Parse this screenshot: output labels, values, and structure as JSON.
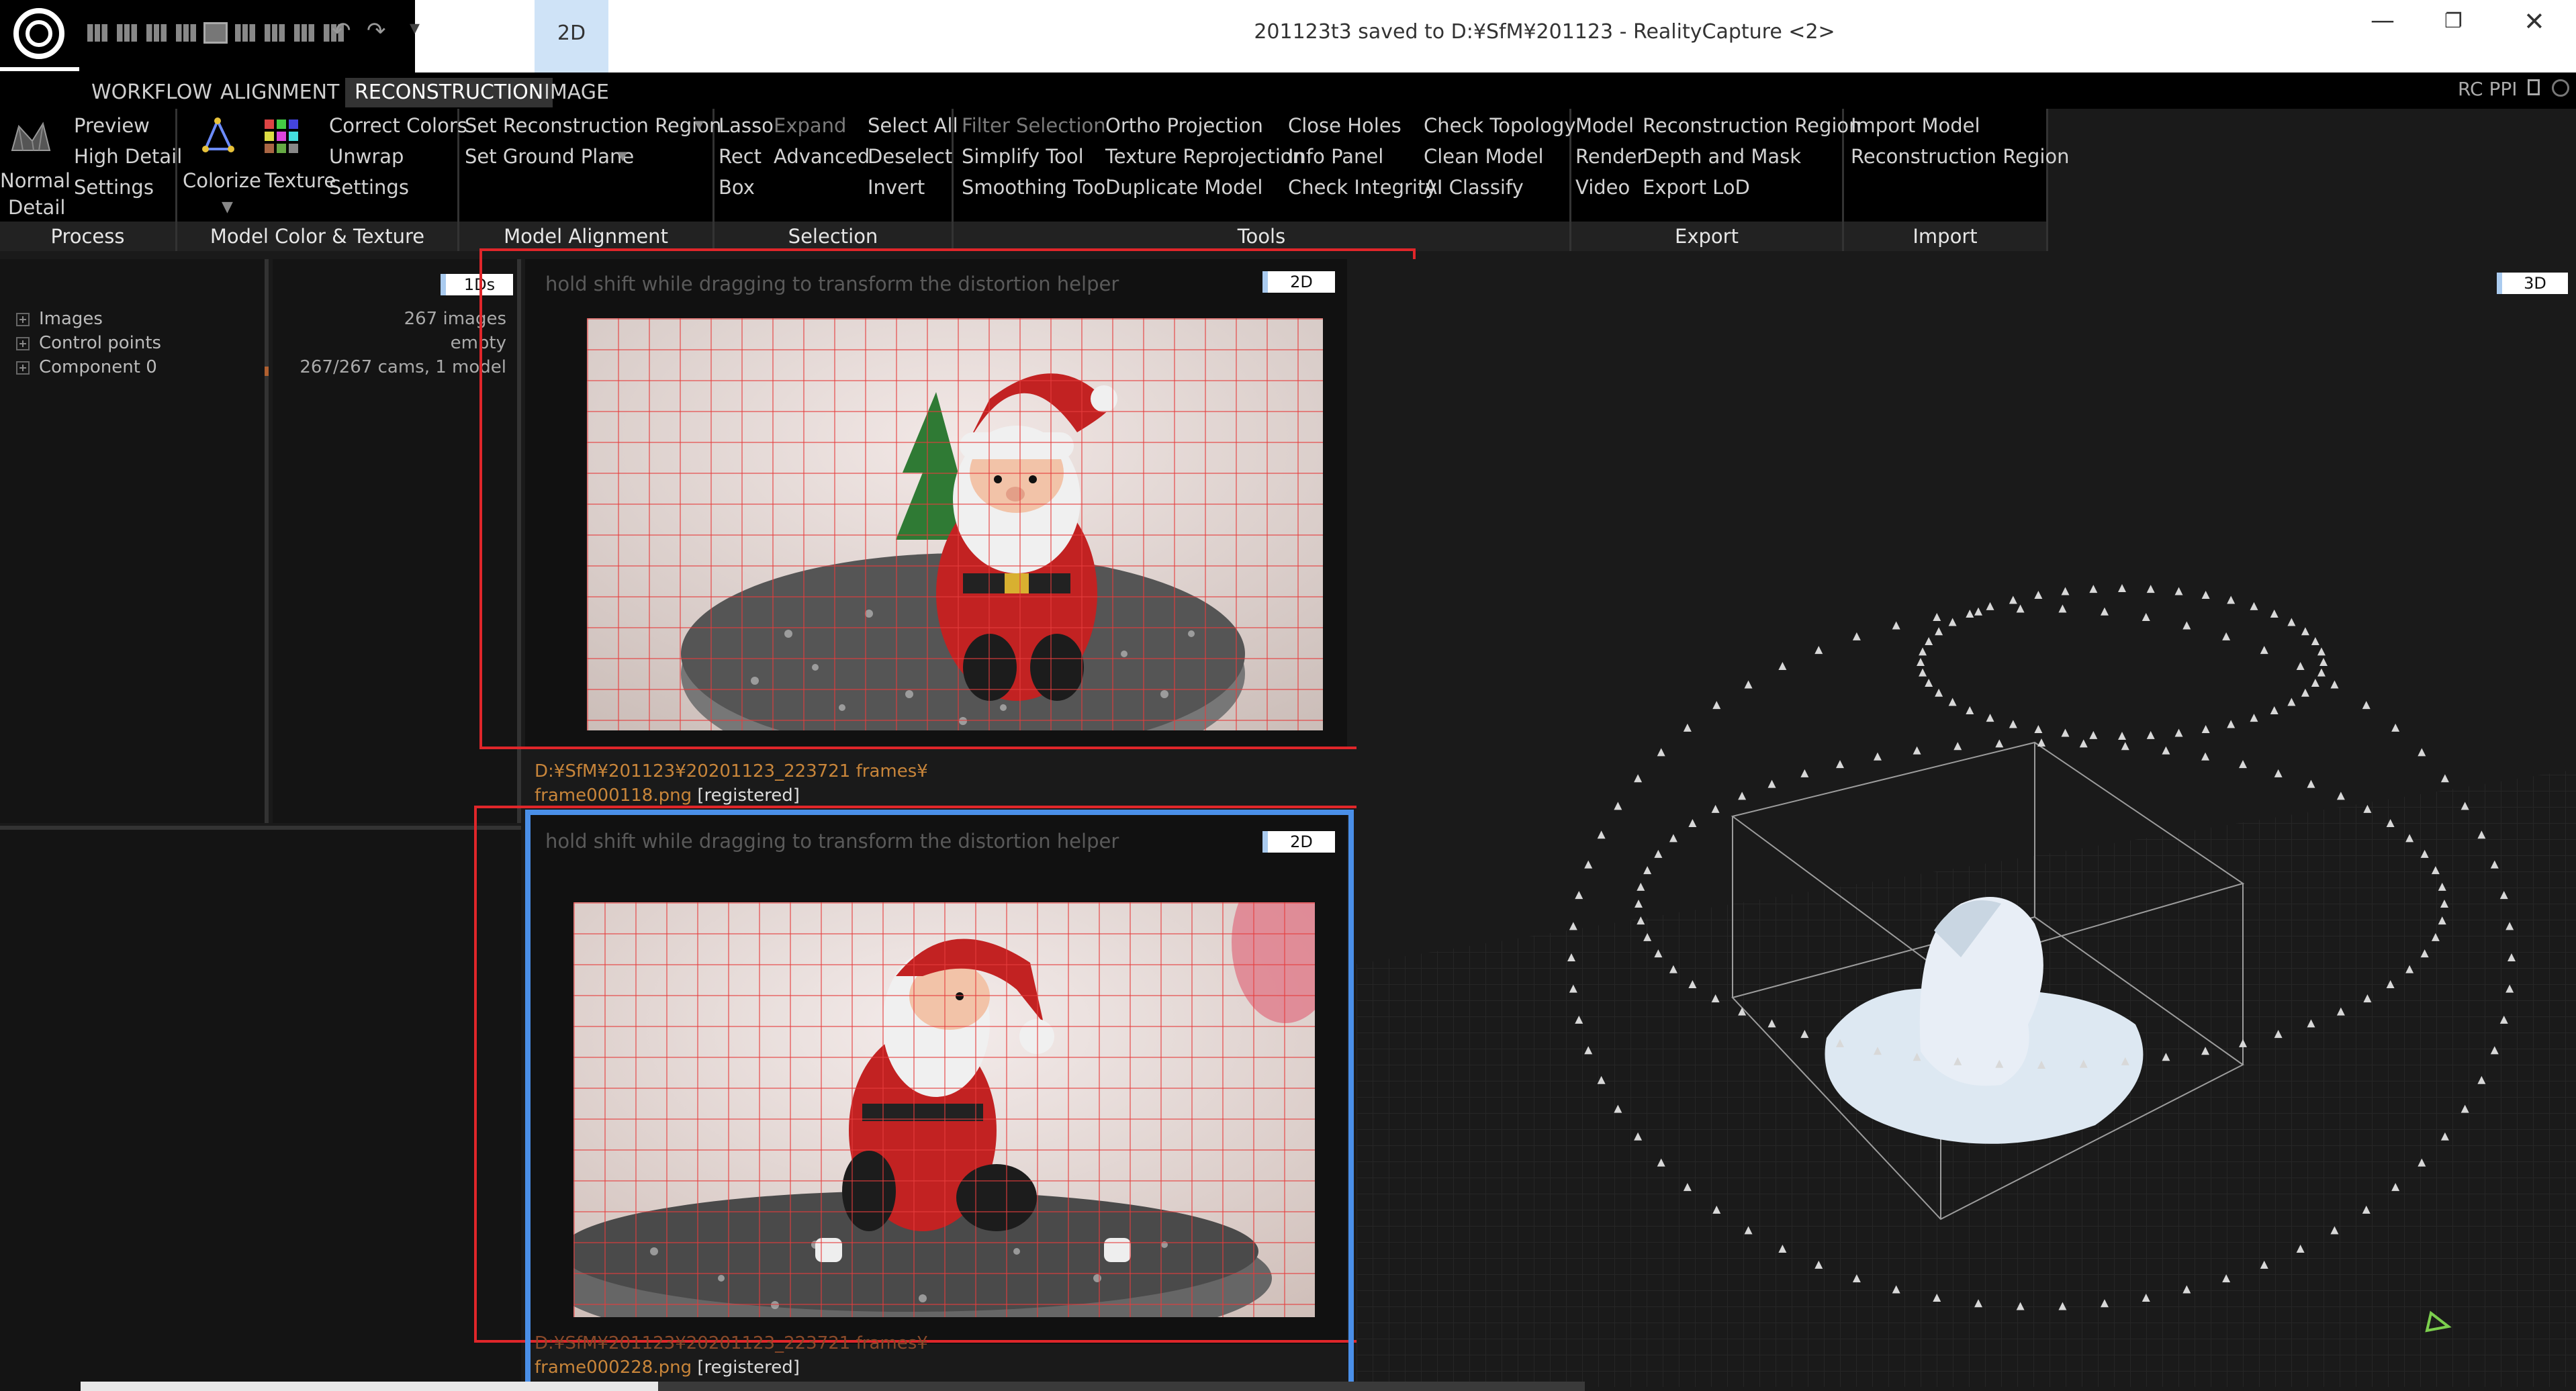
{
  "window": {
    "title": "201123t3 saved to D:¥SfM¥201123 - RealityCapture <2>",
    "top_tab": "2D",
    "minimize": "—",
    "maximize": "❐",
    "close": "✕"
  },
  "menu": {
    "tabs": [
      "WORKFLOW",
      "ALIGNMENT",
      "RECONSTRUCTION",
      "IMAGE"
    ],
    "active": "RECONSTRUCTION",
    "right_label": "RC PPI"
  },
  "ribbon": {
    "process": {
      "footer": "Process",
      "normal_detail": [
        "Normal",
        "Detail"
      ],
      "items": [
        "Preview",
        "High Detail",
        "Settings"
      ]
    },
    "color_texture": {
      "footer": "Model Color & Texture",
      "colorize": "Colorize",
      "texture": "Texture",
      "items": [
        "Correct Colors",
        "Unwrap",
        "Settings"
      ]
    },
    "alignment": {
      "footer": "Model Alignment",
      "items": [
        "Set Reconstruction Region",
        "Set Ground Plane"
      ]
    },
    "selection": {
      "footer": "Selection",
      "col1": [
        "Lasso",
        "Rect",
        "Box"
      ],
      "col2": [
        "Expand",
        "Advanced"
      ],
      "col3": [
        "Select All",
        "Deselect",
        "Invert"
      ]
    },
    "tools": {
      "footer": "Tools",
      "col1": [
        "Filter Selection",
        "Simplify Tool",
        "Smoothing Tool"
      ],
      "col2": [
        "Ortho Projection",
        "Texture Reprojection",
        "Duplicate Model"
      ],
      "col3": [
        "Close Holes",
        "Info Panel",
        "Check Integrity"
      ],
      "col4": [
        "Check Topology",
        "Clean Model",
        "AI Classify"
      ]
    },
    "export": {
      "footer": "Export",
      "col1": [
        "Model",
        "Render",
        "Video"
      ],
      "col2": [
        "Reconstruction Region",
        "Depth and Mask",
        "Export LoD"
      ]
    },
    "import": {
      "footer": "Import",
      "items": [
        "Import Model",
        "Reconstruction Region"
      ]
    }
  },
  "tree": {
    "items": [
      "Images",
      "Control points",
      "Component 0"
    ]
  },
  "info": {
    "badge": "1Ds",
    "values": [
      "267 images",
      "empty",
      "267/267 cams, 1 model"
    ]
  },
  "viewer_top": {
    "hint": "hold shift while dragging to transform the distortion helper",
    "badge": "2D",
    "path": "D:¥SfM¥201123¥20201123_223721 frames¥",
    "file": "frame000118.png",
    "status": "[registered]"
  },
  "viewer_bottom": {
    "hint": "hold shift while dragging to transform the distortion helper",
    "badge": "2D",
    "path": "D:¥SfM¥201123¥20201123_223721 frames¥",
    "file": "frame000228.png",
    "status": "[registered]"
  },
  "view3d": {
    "badge": "3D"
  },
  "colors": {
    "accent_blue": "#4a8fe8",
    "highlight_red": "#e0262a",
    "path_orange": "#c8853a"
  }
}
